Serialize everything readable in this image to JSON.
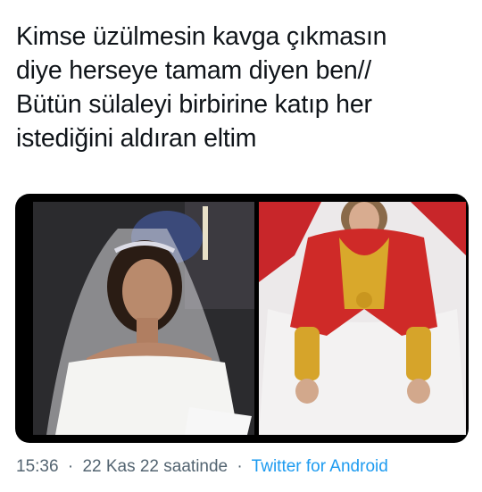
{
  "tweet": {
    "text_lines": [
      "Kimse üzülmesin kavga çıkmasın",
      "diye herseye tamam diyen ben//",
      "Bütün sülaleyi birbirine katıp her",
      "istediğini aldıran eltim"
    ]
  },
  "media": {
    "left_image": "bride-in-white-veil-photo",
    "right_image": "bride-with-red-cape-and-gold-jewelry-photo"
  },
  "meta": {
    "time": "15:36",
    "date": "22 Kas 22 saatinde",
    "separator": "·",
    "source": "Twitter for Android"
  },
  "colors": {
    "text": "#0f1419",
    "meta": "#536471",
    "link": "#1d9bf0"
  }
}
